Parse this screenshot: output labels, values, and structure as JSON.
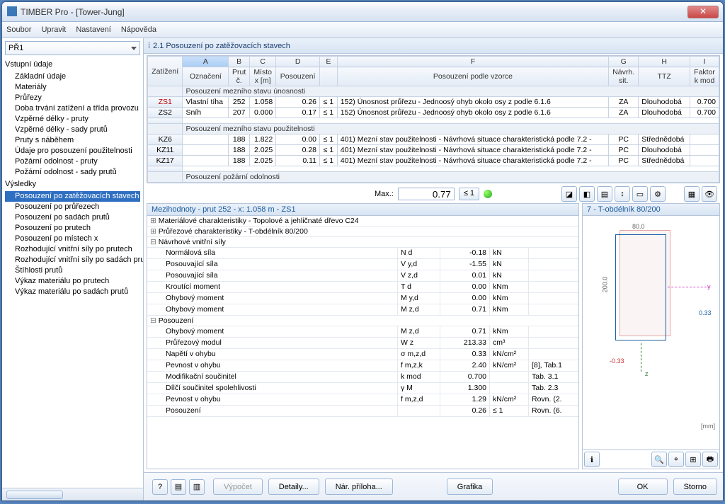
{
  "window_title": "TIMBER Pro - [Tower-Jung]",
  "menu": [
    "Soubor",
    "Upravit",
    "Nastavení",
    "Nápověda"
  ],
  "case_selector": "PŘ1",
  "tree": {
    "group1": "Vstupní údaje",
    "g1_items": [
      "Základní údaje",
      "Materiály",
      "Průřezy",
      "Doba trvání zatížení a třída provozu",
      "Vzpěrné délky - pruty",
      "Vzpěrné délky - sady prutů",
      "Pruty s náběhem",
      "Údaje pro posouzení použitelnosti",
      "Požární odolnost - pruty",
      "Požární odolnost - sady prutů"
    ],
    "group2": "Výsledky",
    "g2_items": [
      "Posouzení po zatěžovacích stavech",
      "Posouzení po průřezech",
      "Posouzení po sadách prutů",
      "Posouzení po prutech",
      "Posouzení po místech x",
      "Rozhodující vnitřní síly po prutech",
      "Rozhodující vnitřní síly po sadách prut",
      "Štíhlosti prutů",
      "Výkaz materiálu po prutech",
      "Výkaz materiálu po sadách prutů"
    ]
  },
  "pane_title": "2.1 Posouzení po zatěžovacích stavech",
  "headers": {
    "cols": [
      "A",
      "B",
      "C",
      "D",
      "E",
      "F",
      "G",
      "H",
      "I"
    ],
    "row2": [
      "Zatížení",
      "Označení",
      "Prut č.",
      "Místo x [m]",
      "Posouzení",
      "",
      "Posouzení podle vzorce",
      "Návrh. sit.",
      "TTZ",
      "Faktor k mod"
    ]
  },
  "sub1": "Posouzení mezního stavu únosnosti",
  "rows1": [
    {
      "id": "ZS1",
      "ozn": "Vlastní tíha",
      "prut": "252",
      "x": "1.058",
      "pos": "0.26",
      "le": "≤ 1",
      "vz": "152) Únosnost průřezu - Jednoosý ohyb okolo osy z podle 6.1.6",
      "sit": "ZA",
      "ttz": "Dlouhodobá",
      "k": "0.700"
    },
    {
      "id": "ZS2",
      "ozn": "Sníh",
      "prut": "207",
      "x": "0.000",
      "pos": "0.17",
      "le": "≤ 1",
      "vz": "152) Únosnost průřezu - Jednoosý ohyb okolo osy z podle 6.1.6",
      "sit": "ZA",
      "ttz": "Dlouhodobá",
      "k": "0.700"
    }
  ],
  "sub2": "Posouzení mezního stavu použitelnosti",
  "rows2": [
    {
      "id": "KZ6",
      "ozn": "",
      "prut": "188",
      "x": "1.822",
      "pos": "0.00",
      "le": "≤ 1",
      "vz": "401) Mezní stav použitelnosti - Návrhová situace charakteristická podle 7.2 -",
      "sit": "PC",
      "ttz": "Střednědobá",
      "k": ""
    },
    {
      "id": "KZ11",
      "ozn": "",
      "prut": "188",
      "x": "2.025",
      "pos": "0.28",
      "le": "≤ 1",
      "vz": "401) Mezní stav použitelnosti - Návrhová situace charakteristická podle 7.2 -",
      "sit": "PC",
      "ttz": "Dlouhodobá",
      "k": ""
    },
    {
      "id": "KZ17",
      "ozn": "",
      "prut": "188",
      "x": "2.025",
      "pos": "0.11",
      "le": "≤ 1",
      "vz": "401) Mezní stav použitelnosti - Návrhová situace charakteristická podle 7.2 -",
      "sit": "PC",
      "ttz": "Střednědobá",
      "k": ""
    }
  ],
  "sub3": "Posouzení požární odolnosti",
  "max_label": "Max.:",
  "max_value": "0.77",
  "max_le": "≤ 1",
  "detail_title": "Mezihodnoty - prut 252 - x: 1.058 m - ZS1",
  "groups": [
    "Materiálové charakteristiky - Topolové a jehličnaté dřevo C24",
    "Průřezové charakteristiky - T-obdélník 80/200",
    "Návrhové vnitřní síly"
  ],
  "forces": [
    {
      "n": "Normálová síla",
      "s": "N d",
      "v": "-0.18",
      "u": "kN"
    },
    {
      "n": "Posouvající síla",
      "s": "V y,d",
      "v": "-1.55",
      "u": "kN"
    },
    {
      "n": "Posouvající síla",
      "s": "V z,d",
      "v": "0.01",
      "u": "kN"
    },
    {
      "n": "Kroutící moment",
      "s": "T d",
      "v": "0.00",
      "u": "kNm"
    },
    {
      "n": "Ohybový moment",
      "s": "M y,d",
      "v": "0.00",
      "u": "kNm"
    },
    {
      "n": "Ohybový moment",
      "s": "M z,d",
      "v": "0.71",
      "u": "kNm"
    }
  ],
  "group4": "Posouzení",
  "checks": [
    {
      "n": "Ohybový moment",
      "s": "M z,d",
      "v": "0.71",
      "u": "kNm",
      "r": ""
    },
    {
      "n": "Průřezový modul",
      "s": "W z",
      "v": "213.33",
      "u": "cm³",
      "r": ""
    },
    {
      "n": "Napětí v ohybu",
      "s": "σ m,z,d",
      "v": "0.33",
      "u": "kN/cm²",
      "r": ""
    },
    {
      "n": "Pevnost v ohybu",
      "s": "f m,z,k",
      "v": "2.40",
      "u": "kN/cm²",
      "r": "[8], Tab.1"
    },
    {
      "n": "Modifikační součinitel",
      "s": "k mod",
      "v": "0.700",
      "u": "",
      "r": "Tab. 3.1"
    },
    {
      "n": "Dílčí součinitel spolehlivosti",
      "s": "γ M",
      "v": "1.300",
      "u": "",
      "r": "Tab. 2.3"
    },
    {
      "n": "Pevnost v ohybu",
      "s": "f m,z,d",
      "v": "1.29",
      "u": "kN/cm²",
      "r": "Rovn. (2."
    },
    {
      "n": "Posouzení",
      "s": "",
      "v": "0.26",
      "u": "",
      "r": "Rovn. (6.",
      "le": "≤ 1"
    }
  ],
  "preview_title": "7 - T-obdélník 80/200",
  "dim_w": "80.0",
  "dim_h": "200.0",
  "axis_y": "y",
  "axis_z": "z",
  "valp": "0.33",
  "valn": "-0.33",
  "unit": "[mm]",
  "buttons": {
    "vypocet": "Výpočet",
    "detaily": "Detaily...",
    "priloha": "Nár. příloha...",
    "grafika": "Grafika",
    "ok": "OK",
    "storno": "Storno"
  }
}
